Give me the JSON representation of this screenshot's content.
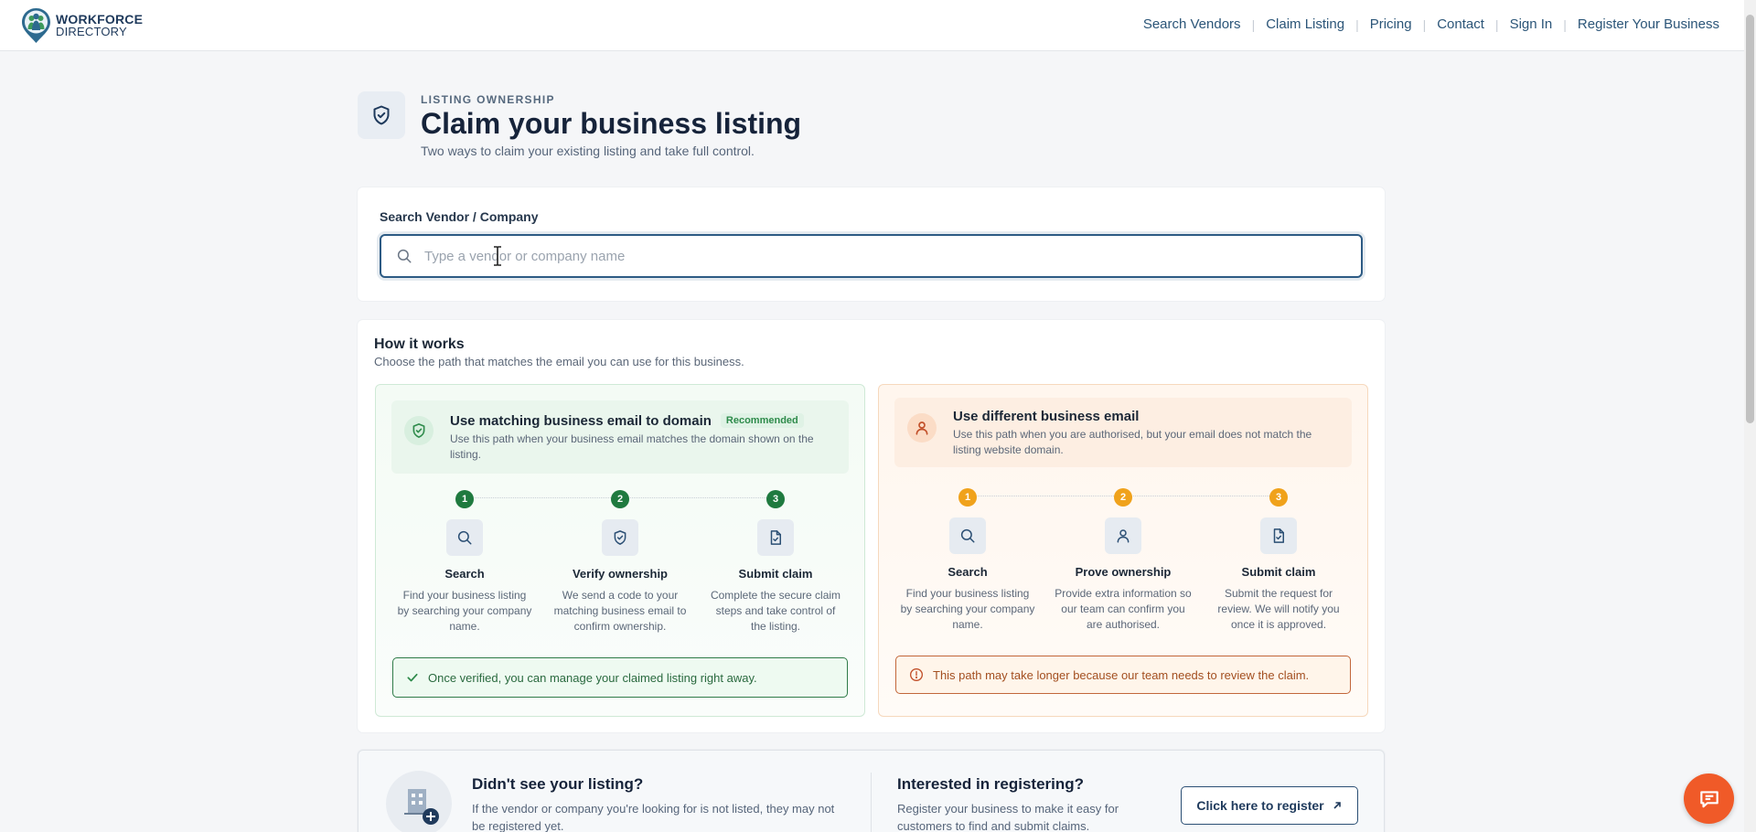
{
  "header": {
    "logo_line1": "WORKFORCE",
    "logo_line2": "DIRECTORY",
    "nav": [
      "Search Vendors",
      "Claim Listing",
      "Pricing",
      "Contact",
      "Sign In",
      "Register Your Business"
    ]
  },
  "page": {
    "eyebrow": "LISTING OWNERSHIP",
    "title": "Claim your business listing",
    "subtitle": "Two ways to claim your existing listing and take full control."
  },
  "search": {
    "label": "Search Vendor / Company",
    "placeholder": "Type a vendor or company name",
    "value": ""
  },
  "how_it_works": {
    "title": "How it works",
    "subtitle": "Choose the path that matches the email you can use for this business.",
    "paths": [
      {
        "title": "Use matching business email to domain",
        "badge": "Recommended",
        "description": "Use this path when your business email matches the domain shown on the listing.",
        "steps": [
          {
            "num": "1",
            "icon": "search-icon",
            "title": "Search",
            "desc": "Find your business listing by searching your company name."
          },
          {
            "num": "2",
            "icon": "shield-check-icon",
            "title": "Verify ownership",
            "desc": "We send a code to your matching business email to confirm ownership."
          },
          {
            "num": "3",
            "icon": "document-check-icon",
            "title": "Submit claim",
            "desc": "Complete the secure claim steps and take control of the listing."
          }
        ],
        "note": "Once verified, you can manage your claimed listing right away."
      },
      {
        "title": "Use different business email",
        "description": "Use this path when you are authorised, but your email does not match the listing website domain.",
        "steps": [
          {
            "num": "1",
            "icon": "search-icon",
            "title": "Search",
            "desc": "Find your business listing by searching your company name."
          },
          {
            "num": "2",
            "icon": "user-icon",
            "title": "Prove ownership",
            "desc": "Provide extra information so our team can confirm you are authorised."
          },
          {
            "num": "3",
            "icon": "document-check-icon",
            "title": "Submit claim",
            "desc": "Submit the request for review. We will notify you once it is approved."
          }
        ],
        "note": "This path may take longer because our team needs to review the claim."
      }
    ]
  },
  "bottom": {
    "left_title": "Didn't see your listing?",
    "left_desc": "If the vendor or company you're looking for is not listed, they may not be registered yet.",
    "right_title": "Interested in registering?",
    "right_desc": "Register your business to make it easy for customers to find and submit claims.",
    "register_button": "Click here to register",
    "register_icon": "external-link-icon"
  },
  "colors": {
    "brand": "#1f3a5c",
    "green": "#1f7a3f",
    "orange": "#f0a21b",
    "chat": "#f05a28"
  }
}
